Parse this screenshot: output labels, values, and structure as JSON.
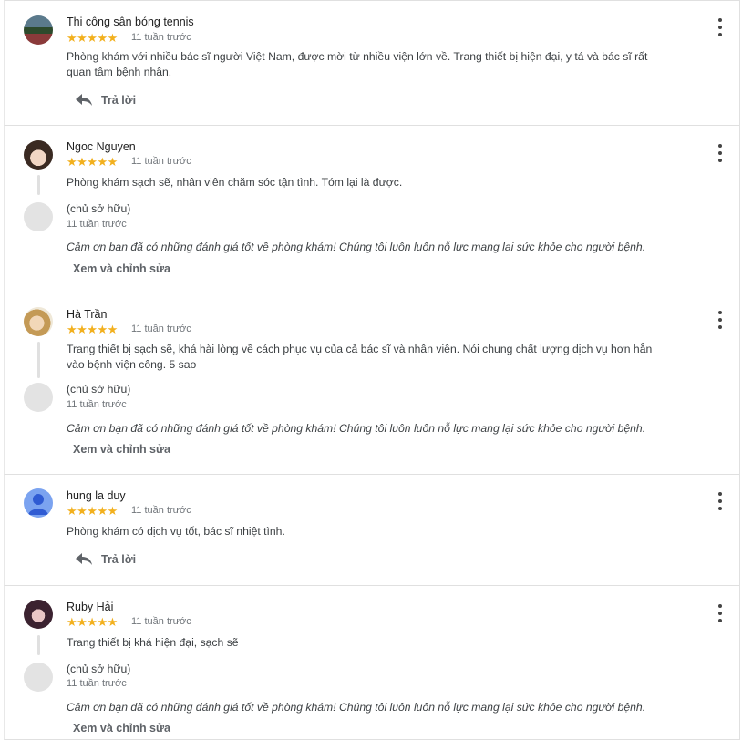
{
  "review_action_label": "Trả lời",
  "owner_label": "(chủ sở hữu)",
  "owner_edit_label": "Xem và chỉnh sửa",
  "owner_reply_text": "Cảm ơn bạn đã có những đánh giá tốt về phòng khám! Chúng tôi luôn luôn nỗ lực mang lại sức khỏe cho người bệnh.",
  "stars": "★★★★★",
  "reviews": [
    {
      "name": "Thi công sân bóng tennis",
      "rating": 5,
      "time": "11 tuần trước",
      "text": "Phòng khám với nhiều bác sĩ người Việt Nam, được mời từ nhiều viện lớn về. Trang thiết bị hiện đại, y tá và bác sĩ rất quan tâm bệnh nhân.",
      "owner_time": null
    },
    {
      "name": "Ngoc Nguyen",
      "rating": 5,
      "time": "11 tuần trước",
      "text": "Phòng khám sạch sẽ, nhân viên chăm sóc tận tình. Tóm lại là được.",
      "owner_time": "11 tuần trước"
    },
    {
      "name": "Hà Trần",
      "rating": 5,
      "time": "11 tuần trước",
      "text": "Trang thiết bị sạch sẽ, khá hài lòng về cách phục vụ của cả bác sĩ và nhân viên. Nói chung chất lượng dịch vụ hơn hẳn vào bệnh viện công. 5 sao",
      "owner_time": "11 tuần trước"
    },
    {
      "name": "hung la duy",
      "rating": 5,
      "time": "11 tuần trước",
      "text": "Phòng khám có dịch vụ tốt, bác sĩ nhiệt tình.",
      "owner_time": null
    },
    {
      "name": "Ruby Hải",
      "rating": 5,
      "time": "11 tuần trước",
      "text": "Trang thiết bị khá hiện đại, sạch sẽ",
      "owner_time": "11 tuần trước"
    }
  ],
  "colors": {
    "star": "#f2b01e",
    "text": "#3c4043",
    "muted": "#70757a",
    "divider": "#e0e0e0"
  }
}
